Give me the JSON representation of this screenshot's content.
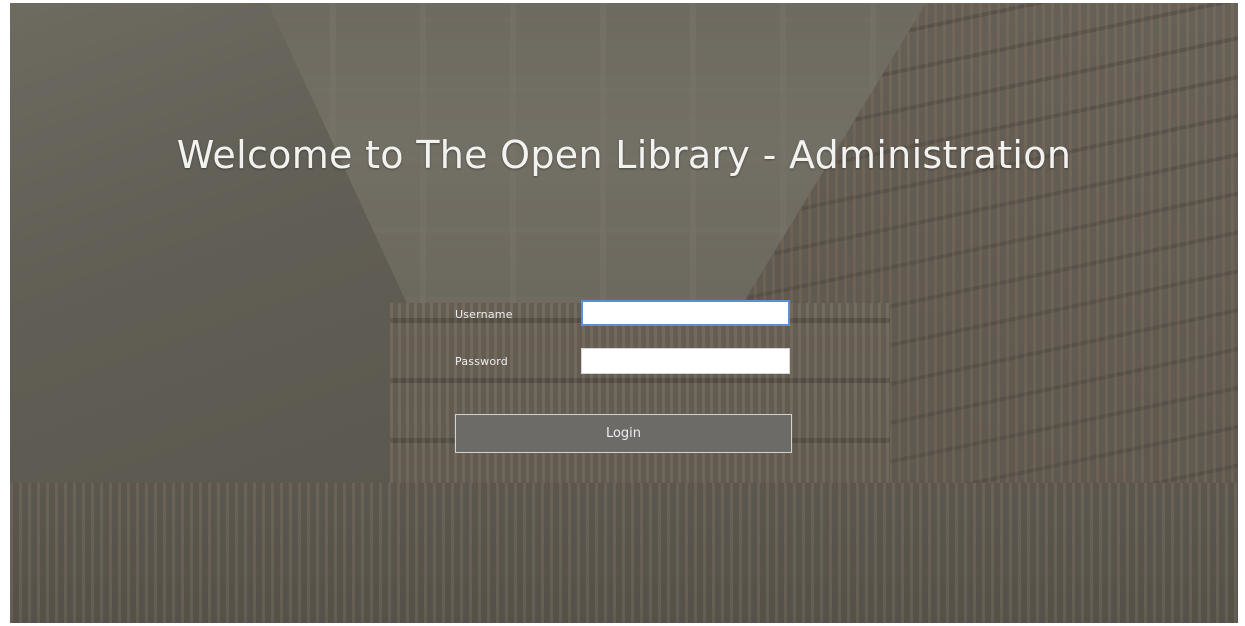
{
  "page": {
    "title": "Welcome to The Open Library - Administration"
  },
  "login_form": {
    "username_label": "Username",
    "username_value": "",
    "password_label": "Password",
    "password_value": "",
    "login_label": "Login"
  },
  "colors": {
    "focus_border": "#5b8fd6",
    "button_bg": "#6c6b68",
    "title_text": "#f2f2f0"
  }
}
